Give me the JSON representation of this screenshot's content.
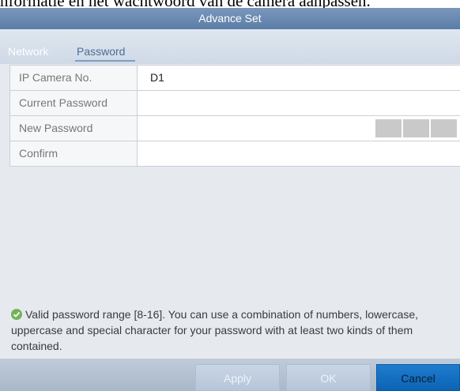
{
  "caption": "nformatie en het wachtwoord van de camera aanpassen.",
  "dialog": {
    "title": "Advance Set"
  },
  "tabs": [
    {
      "label": "Network",
      "active": false
    },
    {
      "label": "Password",
      "active": true
    }
  ],
  "form": {
    "rows": [
      {
        "label": "IP Camera No.",
        "value": "D1"
      },
      {
        "label": "Current Password",
        "value": ""
      },
      {
        "label": "New Password",
        "value": "",
        "strength_segments": 3
      },
      {
        "label": "Confirm",
        "value": ""
      }
    ]
  },
  "notice": {
    "icon": "check-circle-icon",
    "text": "Valid password range [8-16]. You can use a combination of numbers, lowercase, uppercase and special character for your password with at least two kinds of them contained."
  },
  "buttons": {
    "apply": "Apply",
    "ok": "OK",
    "cancel": "Cancel"
  },
  "colors": {
    "title_bar": "#5b7ca5",
    "accent_tab": "#4a6f9a",
    "cancel_button": "#1f7ccd",
    "check_icon": "#74b25a"
  }
}
